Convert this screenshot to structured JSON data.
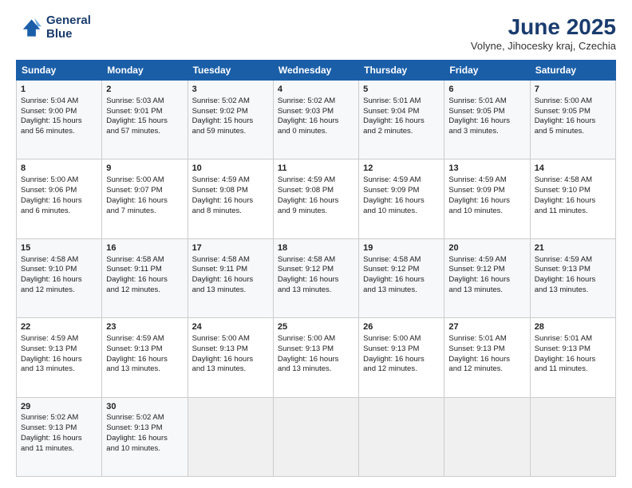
{
  "header": {
    "logo_line1": "General",
    "logo_line2": "Blue",
    "title": "June 2025",
    "subtitle": "Volyne, Jihocesky kraj, Czechia"
  },
  "days_of_week": [
    "Sunday",
    "Monday",
    "Tuesday",
    "Wednesday",
    "Thursday",
    "Friday",
    "Saturday"
  ],
  "weeks": [
    [
      {
        "day": "1",
        "info": "Sunrise: 5:04 AM\nSunset: 9:00 PM\nDaylight: 15 hours\nand 56 minutes."
      },
      {
        "day": "2",
        "info": "Sunrise: 5:03 AM\nSunset: 9:01 PM\nDaylight: 15 hours\nand 57 minutes."
      },
      {
        "day": "3",
        "info": "Sunrise: 5:02 AM\nSunset: 9:02 PM\nDaylight: 15 hours\nand 59 minutes."
      },
      {
        "day": "4",
        "info": "Sunrise: 5:02 AM\nSunset: 9:03 PM\nDaylight: 16 hours\nand 0 minutes."
      },
      {
        "day": "5",
        "info": "Sunrise: 5:01 AM\nSunset: 9:04 PM\nDaylight: 16 hours\nand 2 minutes."
      },
      {
        "day": "6",
        "info": "Sunrise: 5:01 AM\nSunset: 9:05 PM\nDaylight: 16 hours\nand 3 minutes."
      },
      {
        "day": "7",
        "info": "Sunrise: 5:00 AM\nSunset: 9:05 PM\nDaylight: 16 hours\nand 5 minutes."
      }
    ],
    [
      {
        "day": "8",
        "info": "Sunrise: 5:00 AM\nSunset: 9:06 PM\nDaylight: 16 hours\nand 6 minutes."
      },
      {
        "day": "9",
        "info": "Sunrise: 5:00 AM\nSunset: 9:07 PM\nDaylight: 16 hours\nand 7 minutes."
      },
      {
        "day": "10",
        "info": "Sunrise: 4:59 AM\nSunset: 9:08 PM\nDaylight: 16 hours\nand 8 minutes."
      },
      {
        "day": "11",
        "info": "Sunrise: 4:59 AM\nSunset: 9:08 PM\nDaylight: 16 hours\nand 9 minutes."
      },
      {
        "day": "12",
        "info": "Sunrise: 4:59 AM\nSunset: 9:09 PM\nDaylight: 16 hours\nand 10 minutes."
      },
      {
        "day": "13",
        "info": "Sunrise: 4:59 AM\nSunset: 9:09 PM\nDaylight: 16 hours\nand 10 minutes."
      },
      {
        "day": "14",
        "info": "Sunrise: 4:58 AM\nSunset: 9:10 PM\nDaylight: 16 hours\nand 11 minutes."
      }
    ],
    [
      {
        "day": "15",
        "info": "Sunrise: 4:58 AM\nSunset: 9:10 PM\nDaylight: 16 hours\nand 12 minutes."
      },
      {
        "day": "16",
        "info": "Sunrise: 4:58 AM\nSunset: 9:11 PM\nDaylight: 16 hours\nand 12 minutes."
      },
      {
        "day": "17",
        "info": "Sunrise: 4:58 AM\nSunset: 9:11 PM\nDaylight: 16 hours\nand 13 minutes."
      },
      {
        "day": "18",
        "info": "Sunrise: 4:58 AM\nSunset: 9:12 PM\nDaylight: 16 hours\nand 13 minutes."
      },
      {
        "day": "19",
        "info": "Sunrise: 4:58 AM\nSunset: 9:12 PM\nDaylight: 16 hours\nand 13 minutes."
      },
      {
        "day": "20",
        "info": "Sunrise: 4:59 AM\nSunset: 9:12 PM\nDaylight: 16 hours\nand 13 minutes."
      },
      {
        "day": "21",
        "info": "Sunrise: 4:59 AM\nSunset: 9:13 PM\nDaylight: 16 hours\nand 13 minutes."
      }
    ],
    [
      {
        "day": "22",
        "info": "Sunrise: 4:59 AM\nSunset: 9:13 PM\nDaylight: 16 hours\nand 13 minutes."
      },
      {
        "day": "23",
        "info": "Sunrise: 4:59 AM\nSunset: 9:13 PM\nDaylight: 16 hours\nand 13 minutes."
      },
      {
        "day": "24",
        "info": "Sunrise: 5:00 AM\nSunset: 9:13 PM\nDaylight: 16 hours\nand 13 minutes."
      },
      {
        "day": "25",
        "info": "Sunrise: 5:00 AM\nSunset: 9:13 PM\nDaylight: 16 hours\nand 13 minutes."
      },
      {
        "day": "26",
        "info": "Sunrise: 5:00 AM\nSunset: 9:13 PM\nDaylight: 16 hours\nand 12 minutes."
      },
      {
        "day": "27",
        "info": "Sunrise: 5:01 AM\nSunset: 9:13 PM\nDaylight: 16 hours\nand 12 minutes."
      },
      {
        "day": "28",
        "info": "Sunrise: 5:01 AM\nSunset: 9:13 PM\nDaylight: 16 hours\nand 11 minutes."
      }
    ],
    [
      {
        "day": "29",
        "info": "Sunrise: 5:02 AM\nSunset: 9:13 PM\nDaylight: 16 hours\nand 11 minutes."
      },
      {
        "day": "30",
        "info": "Sunrise: 5:02 AM\nSunset: 9:13 PM\nDaylight: 16 hours\nand 10 minutes."
      },
      {
        "day": "",
        "info": ""
      },
      {
        "day": "",
        "info": ""
      },
      {
        "day": "",
        "info": ""
      },
      {
        "day": "",
        "info": ""
      },
      {
        "day": "",
        "info": ""
      }
    ]
  ]
}
